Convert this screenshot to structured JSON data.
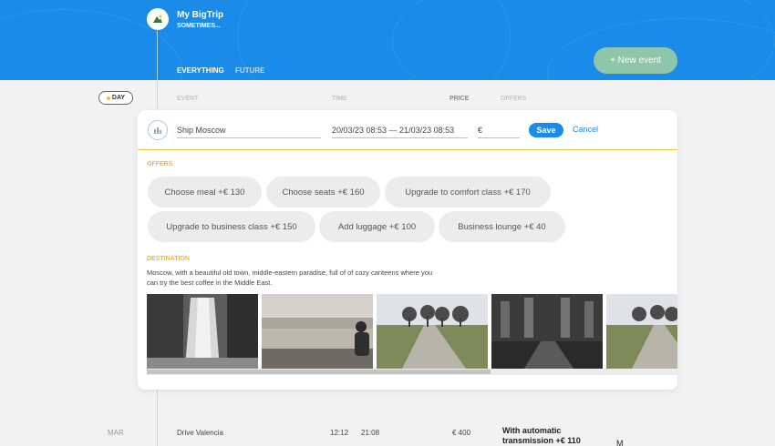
{
  "header": {
    "title": "My BigTrip",
    "subtitle": "SOMETIMES...",
    "filters": [
      "EVERYTHING",
      "FUTURE"
    ],
    "new_event_label": "+ New event",
    "logo_icon": "mountain-logo-icon"
  },
  "sort": {
    "day_label": "DAY",
    "columns": [
      "EVENT",
      "TIME",
      "PRICE",
      "OFFERS"
    ]
  },
  "edit_form": {
    "type_icon": "ship-icon",
    "destination_value": "Ship Moscow",
    "time_value": "20/03/23 08:53 — 21/03/23 08:53",
    "price_value": "€",
    "save_label": "Save",
    "cancel_label": "Cancel"
  },
  "offers": {
    "title": "OFFERS",
    "items": [
      "Choose meal +€  130",
      "Choose seats +€  160",
      "Upgrade to comfort class +€  170",
      "Upgrade to business class +€  150",
      "Add luggage +€  100",
      "Business lounge +€  40"
    ]
  },
  "destination": {
    "title": "DESTINATION",
    "description": "Moscow, with a beautiful old town, middle-eastern paradise, full of of cozy canteens where you can try the best coffee in the Middle East.",
    "photos": [
      "waterfall",
      "man-by-lake",
      "tree-lined-road",
      "church-interior",
      "tree-lined-road"
    ]
  },
  "bottom_row": {
    "date": "MAR",
    "event": "Drive Valencia",
    "time_start": "12:12",
    "time_end": "21:08",
    "price": "€ 400",
    "offer_line1": "With automatic",
    "offer_line2": "transmission +€  110",
    "more": "M"
  }
}
